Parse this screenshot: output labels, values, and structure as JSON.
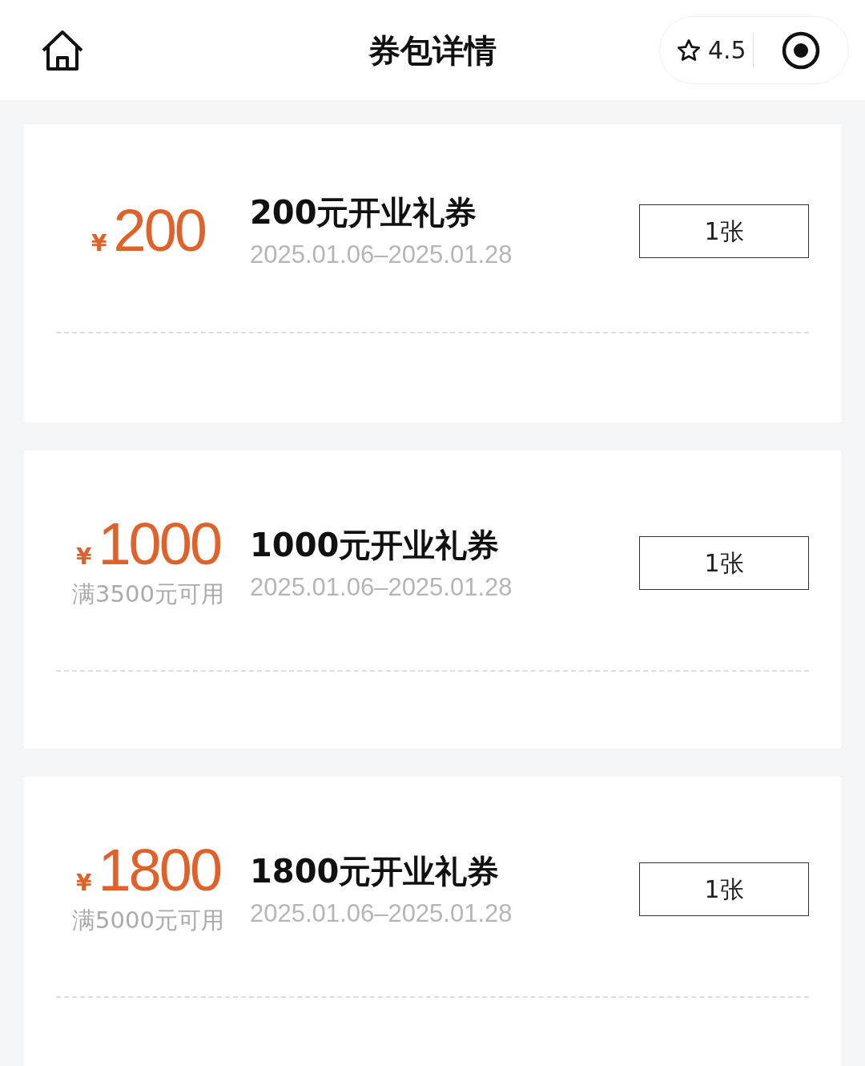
{
  "header": {
    "title": "券包详情",
    "rating": "4.5"
  },
  "coupons": [
    {
      "currency": "¥",
      "amount": "200",
      "title": "200元开业礼券",
      "validity": "2025.01.06–2025.01.28",
      "quantity": "1张"
    },
    {
      "currency": "¥",
      "amount": "1000",
      "condition": "满3500元可用",
      "title": "1000元开业礼券",
      "validity": "2025.01.06–2025.01.28",
      "quantity": "1张"
    },
    {
      "currency": "¥",
      "amount": "1800",
      "condition": "满5000元可用",
      "title": "1800元开业礼券",
      "validity": "2025.01.06–2025.01.28",
      "quantity": "1张"
    }
  ]
}
